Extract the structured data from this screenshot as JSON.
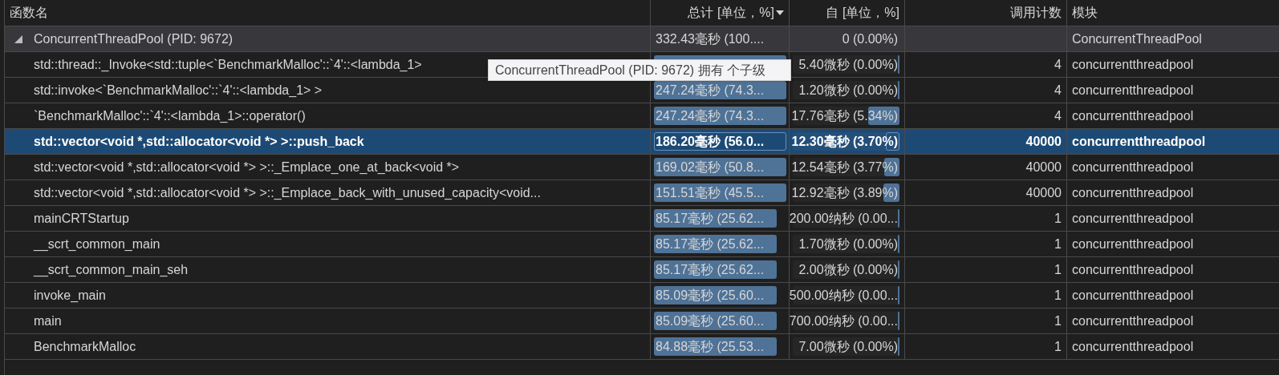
{
  "columns": [
    {
      "label": "函数名",
      "sorted_descending": false
    },
    {
      "label": "总计 [单位，%]",
      "sorted_descending": true
    },
    {
      "label": "自 [单位，%]",
      "sorted_descending": false
    },
    {
      "label": "调用计数",
      "sorted_descending": false
    },
    {
      "label": "模块",
      "sorted_descending": false
    }
  ],
  "rows": [
    {
      "kind": "group",
      "expanded": true,
      "selected": false,
      "name": "ConcurrentThreadPool (PID: 9672)",
      "total": {
        "text": "332.43毫秒 (100...."
      },
      "self": {
        "text": "0 (0.00%)"
      },
      "module": "ConcurrentThreadPool"
    },
    {
      "kind": "function",
      "selected": false,
      "name": "std::thread::_Invoke<std::tuple<`BenchmarkMalloc'::`4'::<lambda_1>",
      "total": {
        "level": 0.98
      },
      "self": {
        "text": "5.40微秒 (0.00%)",
        "level": 0.01
      },
      "calls": "4",
      "module": "concurrentthreadpool"
    },
    {
      "kind": "function",
      "selected": false,
      "name": "std::invoke<`BenchmarkMalloc'::`4'::<lambda_1> >",
      "total": {
        "text": "247.24毫秒 (74.3...",
        "level": 0.98
      },
      "self": {
        "text": "1.20微秒 (0.00%)",
        "level": 0.01
      },
      "calls": "4",
      "module": "concurrentthreadpool"
    },
    {
      "kind": "function",
      "selected": false,
      "name": "`BenchmarkMalloc'::`4'::<lambda_1>::operator()",
      "total": {
        "text": "247.24毫秒 (74.3...",
        "level": 0.98
      },
      "self": {
        "text": "17.76毫秒 (5.34%)",
        "level": 0.29
      },
      "calls": "4",
      "module": "concurrentthreadpool"
    },
    {
      "kind": "function",
      "selected": true,
      "name": "std::vector<void *,std::allocator<void *> >::push_back",
      "total": {
        "text": "186.20毫秒 (56.0...",
        "level": 0.98
      },
      "self": {
        "text": "12.30毫秒 (3.70%)",
        "level": 0.13
      },
      "calls": "40000",
      "module": "concurrentthreadpool"
    },
    {
      "kind": "function",
      "selected": false,
      "name": "std::vector<void *,std::allocator<void *> >::_Emplace_one_at_back<void *>",
      "total": {
        "text": "169.02毫秒 (50.8...",
        "level": 0.98
      },
      "self": {
        "text": "12.54毫秒 (3.77%)",
        "level": 0.14
      },
      "calls": "40000",
      "module": "concurrentthreadpool"
    },
    {
      "kind": "function",
      "selected": false,
      "name": "std::vector<void *,std::allocator<void *> >::_Emplace_back_with_unused_capacity<void...",
      "total": {
        "text": "151.51毫秒 (45.5...",
        "level": 0.98
      },
      "self": {
        "text": "12.92毫秒 (3.89%)",
        "level": 0.15
      },
      "calls": "40000",
      "module": "concurrentthreadpool"
    },
    {
      "kind": "function",
      "selected": false,
      "name": "mainCRTStartup",
      "total": {
        "text": "85.17毫秒 (25.62...",
        "level": 0.91
      },
      "self": {
        "text": "200.00纳秒 (0.00...",
        "level": 0.01
      },
      "calls": "1",
      "module": "concurrentthreadpool"
    },
    {
      "kind": "function",
      "selected": false,
      "name": "__scrt_common_main",
      "total": {
        "text": "85.17毫秒 (25.62...",
        "level": 0.91
      },
      "self": {
        "text": "1.70微秒 (0.00%)",
        "level": 0.01
      },
      "calls": "1",
      "module": "concurrentthreadpool"
    },
    {
      "kind": "function",
      "selected": false,
      "name": "__scrt_common_main_seh",
      "total": {
        "text": "85.17毫秒 (25.62...",
        "level": 0.91
      },
      "self": {
        "text": "2.00微秒 (0.00%)",
        "level": 0.01
      },
      "calls": "1",
      "module": "concurrentthreadpool"
    },
    {
      "kind": "function",
      "selected": false,
      "name": "invoke_main",
      "total": {
        "text": "85.09毫秒 (25.60...",
        "level": 0.91
      },
      "self": {
        "text": "500.00纳秒 (0.00...",
        "level": 0.01
      },
      "calls": "1",
      "module": "concurrentthreadpool"
    },
    {
      "kind": "function",
      "selected": false,
      "name": "main",
      "total": {
        "text": "85.09毫秒 (25.60...",
        "level": 0.91
      },
      "self": {
        "text": "700.00纳秒 (0.00...",
        "level": 0.01
      },
      "calls": "1",
      "module": "concurrentthreadpool"
    },
    {
      "kind": "function",
      "selected": false,
      "name": "BenchmarkMalloc",
      "total": {
        "text": "84.88毫秒 (25.53...",
        "level": 0.91
      },
      "self": {
        "text": "7.00微秒 (0.00%)",
        "level": 0.01
      },
      "calls": "1",
      "module": "concurrentthreadpool"
    }
  ],
  "tooltip": {
    "text": "ConcurrentThreadPool (PID: 9672) 拥有 个子级"
  }
}
